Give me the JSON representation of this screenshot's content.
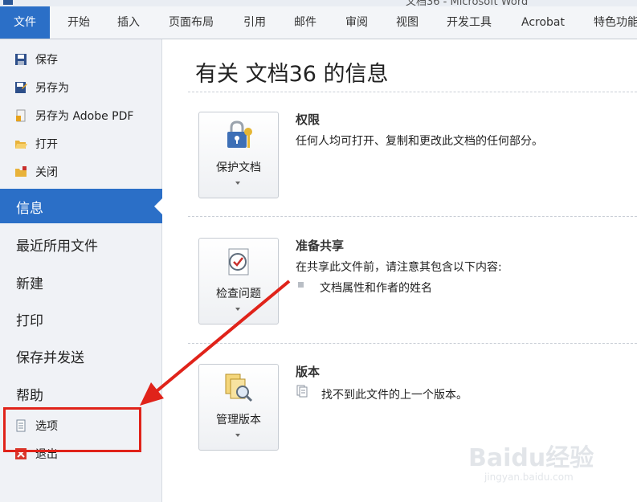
{
  "window": {
    "title": "文档36 - Microsoft Word"
  },
  "ribbon": {
    "tabs": [
      "文件",
      "开始",
      "插入",
      "页面布局",
      "引用",
      "邮件",
      "审阅",
      "视图",
      "开发工具",
      "Acrobat",
      "特色功能"
    ]
  },
  "nav": {
    "save": "保存",
    "save_as": "另存为",
    "save_as_pdf": "另存为 Adobe PDF",
    "open": "打开",
    "close": "关闭",
    "info": "信息",
    "recent": "最近所用文件",
    "new": "新建",
    "print": "打印",
    "save_send": "保存并发送",
    "help": "帮助",
    "options": "选项",
    "exit": "退出"
  },
  "main": {
    "title": "有关 文档36 的信息",
    "permissions": {
      "button": "保护文档",
      "heading": "权限",
      "description": "任何人均可打开、复制和更改此文档的任何部分。"
    },
    "prepare": {
      "button": "检查问题",
      "heading": "准备共享",
      "description": "在共享此文件前，请注意其包含以下内容:",
      "bullet": "文档属性和作者的姓名"
    },
    "versions": {
      "button": "管理版本",
      "heading": "版本",
      "description": "找不到此文件的上一个版本。"
    }
  },
  "watermark": {
    "logo": "Baidu经验",
    "url": "jingyan.baidu.com"
  },
  "colors": {
    "accent": "#2b6fc7",
    "annotation": "#e0231a"
  }
}
